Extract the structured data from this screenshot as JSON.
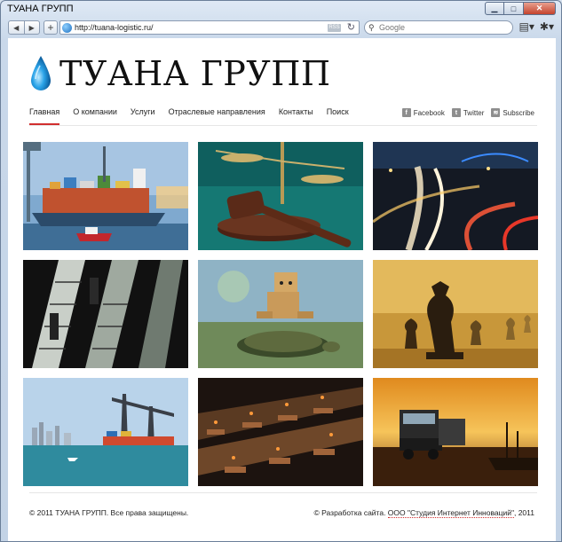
{
  "window": {
    "title": "ТУАНА ГРУПП",
    "minimize_glyph": "▁",
    "maximize_glyph": "□",
    "close_glyph": "✕"
  },
  "toolbar": {
    "back_glyph": "◀",
    "forward_glyph": "▶",
    "add_glyph": "+",
    "url": "http://tuana-logistic.ru/",
    "rss_label": "RSS",
    "reload_glyph": "↻",
    "search_placeholder": "Google",
    "search_glyph": "⚲",
    "page_menu_glyph": "▤▾",
    "settings_glyph": "✱▾"
  },
  "site": {
    "brand": "ТУАНА ГРУПП",
    "nav": [
      {
        "label": "Главная",
        "active": true
      },
      {
        "label": "О компании",
        "active": false
      },
      {
        "label": "Услуги",
        "active": false
      },
      {
        "label": "Отраслевые направления",
        "active": false
      },
      {
        "label": "Контакты",
        "active": false
      },
      {
        "label": "Поиск",
        "active": false
      }
    ],
    "social": [
      {
        "label": "Facebook",
        "icon": "f"
      },
      {
        "label": "Twitter",
        "icon": "t"
      },
      {
        "label": "Subscribe",
        "icon": "≋"
      }
    ]
  },
  "gallery": [
    {
      "subject": "container-ship-port"
    },
    {
      "subject": "gavel-and-scales"
    },
    {
      "subject": "highway-interchange-night"
    },
    {
      "subject": "escalators"
    },
    {
      "subject": "cardboard-robot-on-turtle"
    },
    {
      "subject": "chess-pieces"
    },
    {
      "subject": "port-cranes-city"
    },
    {
      "subject": "container-terminal-aerial"
    },
    {
      "subject": "truck-at-dock-sunset"
    }
  ],
  "footer": {
    "copyright": "© 2011 ТУАНА ГРУПП. Все права защищены.",
    "credit_prefix": "© Разработка сайта. ",
    "credit_link": "ООО \"Студия Интернет Инноваций\"",
    "credit_suffix": ", 2011"
  },
  "colors": {
    "accent": "#d12f2f",
    "chrome": "#c9d8ea",
    "text": "#222222"
  }
}
